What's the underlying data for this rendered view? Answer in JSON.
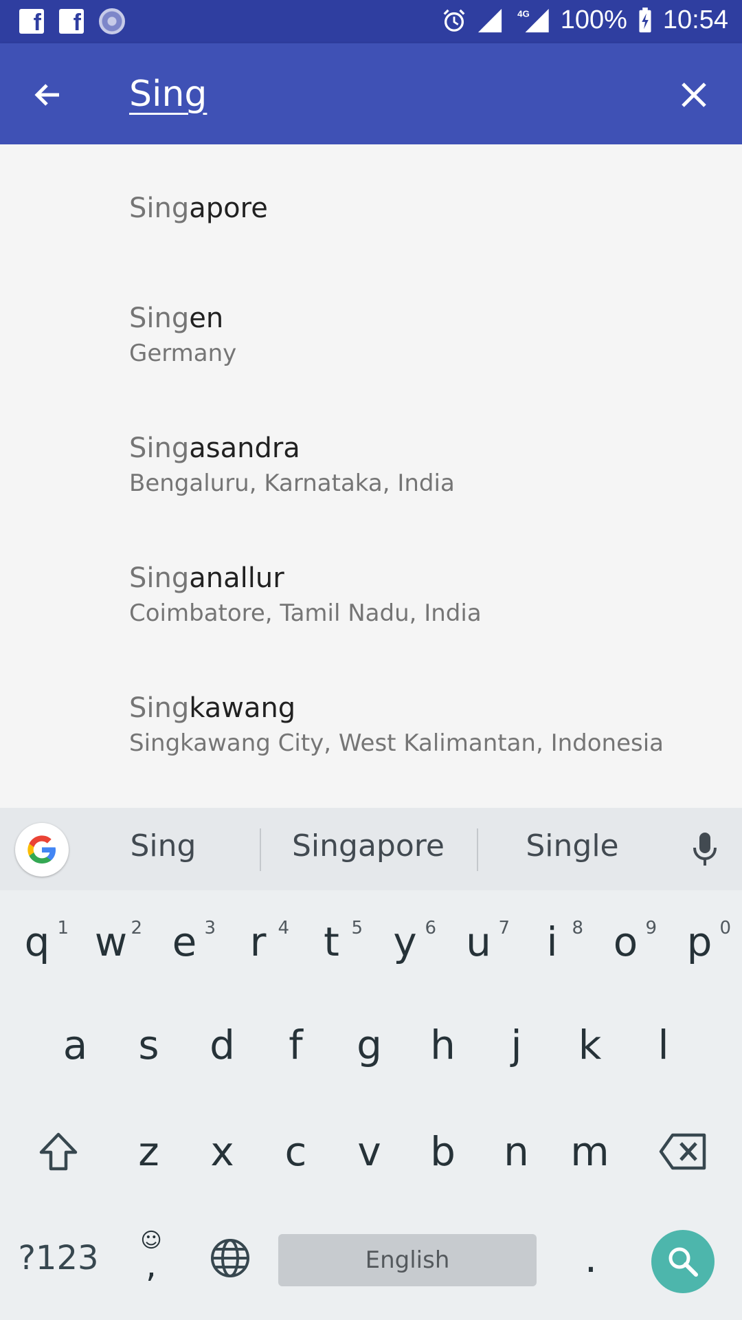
{
  "status_bar": {
    "battery": "100%",
    "time": "10:54",
    "network": "4G",
    "icons": [
      "facebook-icon",
      "facebook-icon",
      "ashoka-chakra-icon",
      "alarm-icon",
      "signal-icon",
      "signal-4g-icon",
      "battery-charging-icon"
    ]
  },
  "app_bar": {
    "query": "Sing",
    "back_icon": "arrow-back-icon",
    "clear_icon": "close-icon",
    "color": "#3f51b5"
  },
  "results": [
    {
      "match": "Sing",
      "rest": "apore",
      "sub": ""
    },
    {
      "match": "Sing",
      "rest": "en",
      "sub": "Germany"
    },
    {
      "match": "Sing",
      "rest": "asandra",
      "sub": "Bengaluru, Karnataka, India"
    },
    {
      "match": "Sing",
      "rest": "anallur",
      "sub": "Coimbatore, Tamil Nadu, India"
    },
    {
      "match": "Sing",
      "rest": "kawang",
      "sub": "Singkawang City, West Kalimantan, Indonesia"
    }
  ],
  "suggestions": [
    "Sing",
    "Singapore",
    "Single"
  ],
  "keyboard": {
    "row1": [
      {
        "key": "q",
        "hint": "1"
      },
      {
        "key": "w",
        "hint": "2"
      },
      {
        "key": "e",
        "hint": "3"
      },
      {
        "key": "r",
        "hint": "4"
      },
      {
        "key": "t",
        "hint": "5"
      },
      {
        "key": "y",
        "hint": "6"
      },
      {
        "key": "u",
        "hint": "7"
      },
      {
        "key": "i",
        "hint": "8"
      },
      {
        "key": "o",
        "hint": "9"
      },
      {
        "key": "p",
        "hint": "0"
      }
    ],
    "row2": [
      "a",
      "s",
      "d",
      "f",
      "g",
      "h",
      "j",
      "k",
      "l"
    ],
    "row3": [
      "z",
      "x",
      "c",
      "v",
      "b",
      "n",
      "m"
    ],
    "symbols_label": "?123",
    "comma_label": ",",
    "emoji_label": "☺",
    "space_label": "English",
    "period_label": ".",
    "accent_color": "#4db6ac"
  }
}
